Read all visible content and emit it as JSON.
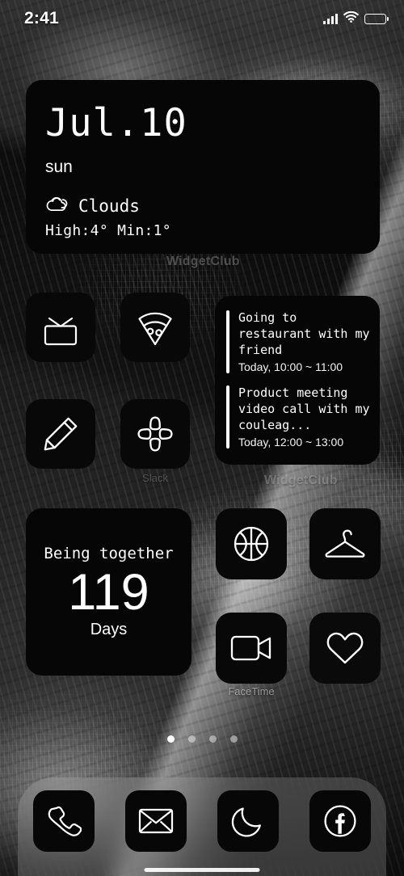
{
  "status_bar": {
    "time": "2:41",
    "icons": [
      "signal-bars-icon",
      "wifi-icon",
      "battery-icon"
    ]
  },
  "date_widget": {
    "date": "Jul.10",
    "weekday": "sun",
    "weather_icon": "cloud-icon",
    "weather_desc": "Clouds",
    "temperature": "High:4° Min:1°"
  },
  "watermarks": {
    "first": "WidgetClub",
    "second": "WidgetClub"
  },
  "app_icons_group_a": [
    {
      "name": "tv-icon",
      "label": ""
    },
    {
      "name": "pizza-icon",
      "label": ""
    },
    {
      "name": "pencil-icon",
      "label": ""
    },
    {
      "name": "slack-icon",
      "label": "Slack"
    }
  ],
  "events_widget": {
    "events": [
      {
        "title": "Going to restaurant with my friend",
        "time": "Today, 10:00 ~ 11:00"
      },
      {
        "title": "Product meeting video call with my couleag...",
        "time": "Today, 12:00 ~ 13:00"
      }
    ]
  },
  "counter_widget": {
    "title": "Being together",
    "number": "119",
    "unit": "Days"
  },
  "app_icons_group_b": [
    {
      "name": "basketball-icon",
      "label": ""
    },
    {
      "name": "hanger-icon",
      "label": ""
    },
    {
      "name": "video-camera-icon",
      "label": "FaceTime"
    },
    {
      "name": "heart-icon",
      "label": ""
    }
  ],
  "page_dots": {
    "count": 4,
    "active_index": 0
  },
  "dock": [
    {
      "name": "phone-icon"
    },
    {
      "name": "mail-icon"
    },
    {
      "name": "moon-icon"
    },
    {
      "name": "facebook-icon"
    }
  ],
  "colors": {
    "widget_background": "#060606",
    "icon_stroke": "#ffffff",
    "dock_background": "rgba(200,200,200,0.22)"
  }
}
